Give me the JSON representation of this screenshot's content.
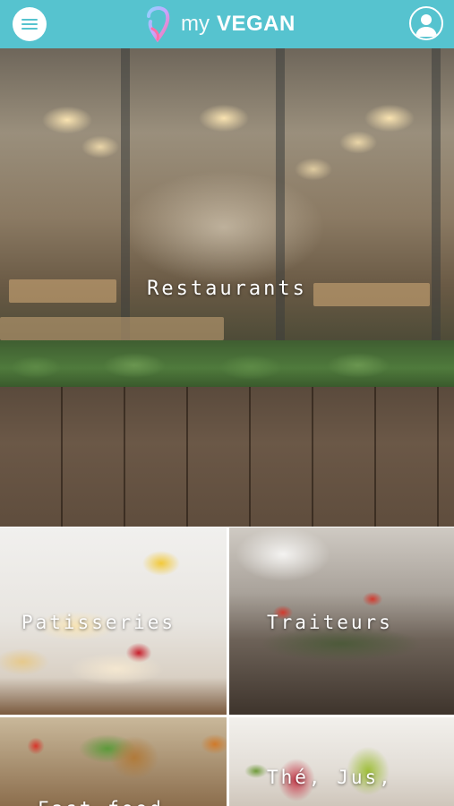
{
  "header": {
    "brand_my": "my",
    "brand_vegan": "VEGAN",
    "background": "#56c3cf"
  },
  "categories": [
    {
      "label": "Restaurants"
    },
    {
      "label": "Patisseries"
    },
    {
      "label": "Traiteurs"
    },
    {
      "label": "Fast-food"
    },
    {
      "label": "Thé, Jus,"
    }
  ]
}
